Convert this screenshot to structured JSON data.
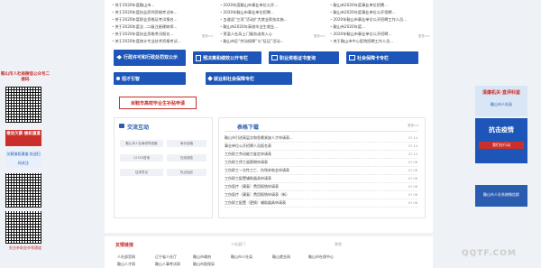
{
  "news_left": [
    "关于2020年度鞍山市...",
    "关于2020年度执业药师资格考试申...",
    "关于2020年度职业资格证考试报名...",
    "关于2020年度全...二级注册建筑师...",
    "关于2020年度执业资格考试报名...",
    "关于2020年度统计专业技术资格考试..."
  ],
  "news_right_a": [
    "2020年度鞍山市事业单位公开...",
    "2020年鞍山市事业单位招聘...",
    "五道县“三项”活动扩大就业帮扶实施...",
    "鞍山市2020年高校毕业生就业...",
    "莱温人社局上门服务送岗入心",
    "鞍山市区“劳动保障”与“征运”活动..."
  ],
  "news_right_b": [
    "鞍山市2020年度事业单位招聘...",
    "鞍山市2020年度事业单位公开招聘...",
    "2020年鞍山市事业单位公开招聘工作人员...",
    "鞍山市2020年度...",
    "2020年鞍山市事业单位公开招聘...",
    "关于鞍山市中心医院招聘工作人员..."
  ],
  "more_label": "更多>>",
  "buttons": [
    "行政许可和行政处罚双公示",
    "预决算和绩效公开专栏",
    "职业资格证书查询",
    "社会保障卡专栏",
    "招才引智",
    "就业和社会保障专栏"
  ],
  "apply_label": "目鞍市高校毕业生补贴申请",
  "exchange": {
    "title": "交流互动",
    "tags": [
      "鞍山市人社局领导信箱",
      "局长信箱",
      "12333咨询",
      "在线调查",
      "征求意见",
      "热点回应"
    ]
  },
  "download": {
    "title": "表格下载",
    "more": "更多>>",
    "rows": [
      {
        "text": "鞍山市引进高层次和急需紧缺人才申请表...",
        "date": "07-14"
      },
      {
        "text": "事业单位公开招聘人员报名表",
        "date": "07-14"
      },
      {
        "text": "工伤职工劳动能力鉴定申请表",
        "date": "07-14"
      },
      {
        "text": "工伤职工停工留薪期申请表",
        "date": "07-06"
      },
      {
        "text": "工伤职工一次性工亡、伤残补助金申请表",
        "date": "07-06"
      },
      {
        "text": "工伤职工配置辅助器具申请表",
        "date": "07-06"
      },
      {
        "text": "工伤医疗（康复）费用报销申请表",
        "date": "07-06"
      },
      {
        "text": "工伤医疗（康复）费用报销申请表（新）",
        "date": "07-06"
      },
      {
        "text": "工伤职工配置（更换）辅助器具申请表",
        "date": "07-06"
      }
    ]
  },
  "footer": {
    "title": "友情链接",
    "groups": [
      "人社部门",
      "其他"
    ],
    "links": [
      "人社部官网",
      "辽宁省人社厅",
      "鞍山市政府",
      "鞍山市人社局",
      "鞍山就业网",
      "鞍山市社保中心",
      "鞍山人才网",
      "鞍山人事考试网",
      "鞍山市医保局"
    ]
  },
  "left_side": {
    "top_text": "鞍山市人社局微信公众号二维码",
    "mid_title": "根治欠薪 维权通道",
    "mid_text": "欠薪维权通道 欢迎扫码关注",
    "bottom_text": "失业补助金申领通道"
  },
  "right_side": {
    "top_title": "清廉机关·直评科室",
    "top_sub": "鞍山市人社局",
    "mid_title": "抗击疫情",
    "mid_sub": "我们在行动",
    "bottom_text": "鞍山市人社系统微信群"
  },
  "watermark": "QQTF.COM",
  "colors": {
    "accent": "#1d56b8",
    "red": "#c9302c"
  }
}
